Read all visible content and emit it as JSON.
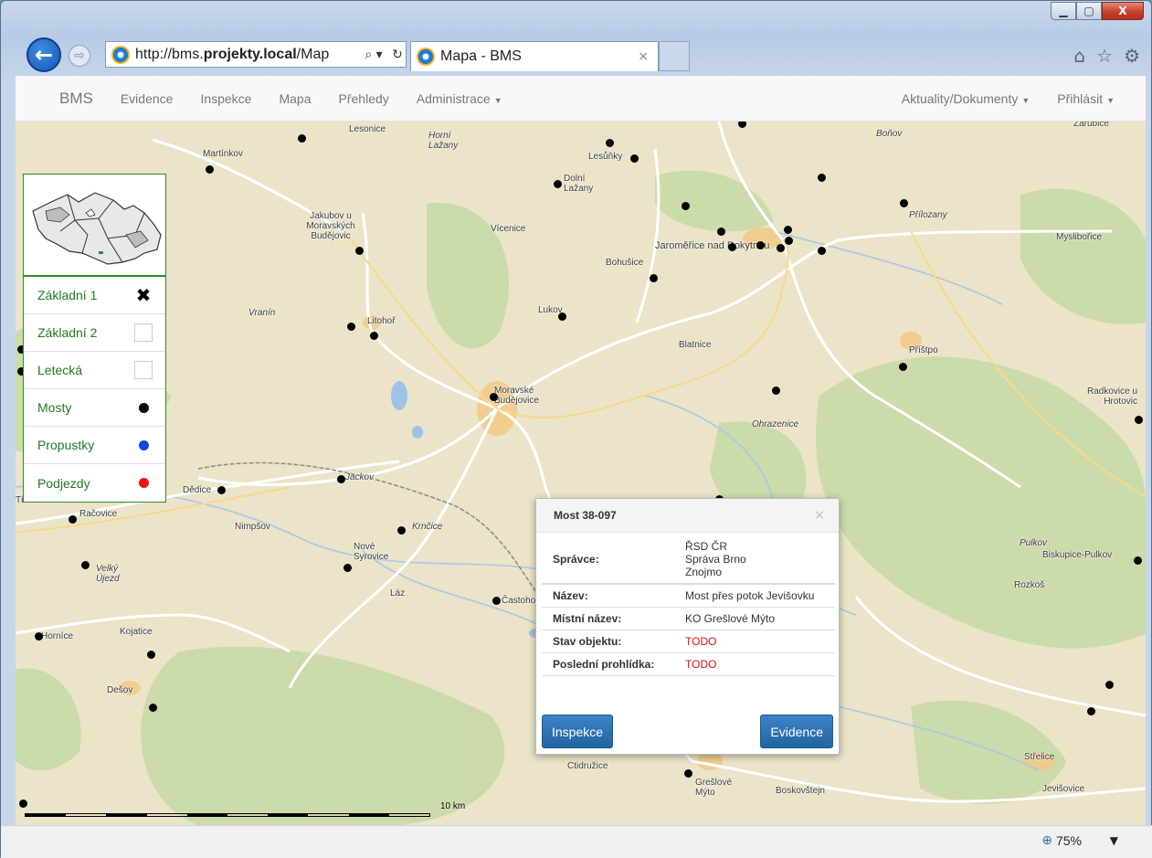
{
  "window": {
    "controls": [
      "▁",
      "▢",
      "X"
    ]
  },
  "browser": {
    "back_icon": "back-arrow-icon",
    "forward_icon": "forward-arrow-icon",
    "url_prefix": "http://bms.",
    "url_host": "projekty.local",
    "url_path": "/Map",
    "search_glyph": "⌕ ▾",
    "refresh_glyph": "↻",
    "tab_title": "Mapa - BMS",
    "tab_close": "×",
    "icons": [
      "home-icon",
      "star-icon",
      "gear-icon"
    ],
    "icon_glyphs": [
      "⌂",
      "☆",
      "⚙"
    ],
    "zoom_label": "75%",
    "zoom_glyph": "⊕",
    "zoom_dropdown": "▼"
  },
  "navbar": {
    "brand": "BMS",
    "items": [
      "Evidence",
      "Inspekce",
      "Mapa",
      "Přehledy",
      "Administrace"
    ],
    "right_items": [
      "Aktuality/Dokumenty",
      "Přihlásit"
    ]
  },
  "layers": [
    {
      "label": "Základní 1",
      "state": "checked"
    },
    {
      "label": "Základní 2",
      "state": "unchecked"
    },
    {
      "label": "Letecká",
      "state": "unchecked"
    },
    {
      "label": "Mosty",
      "color": "#000000"
    },
    {
      "label": "Propustky",
      "color": "#1144ee"
    },
    {
      "label": "Podjezdy",
      "color": "#ee1111"
    }
  ],
  "map": {
    "places": [
      "Lesonice",
      "Horní Lažany",
      "Martínkov",
      "Lesůňky",
      "Dolní Lažany",
      "Boňov",
      "Zárubice",
      "Jakubov u Moravských Budějovic",
      "Vícenice",
      "Jaroměřice nad Rokytnou",
      "Přílozany",
      "Myslibořice",
      "Bohušice",
      "Vranín",
      "Litohoř",
      "Lukov",
      "Blatnice",
      "Příštpo",
      "Moravské Budějovice",
      "Ohrazenice",
      "Radkovice u Hrotovic",
      "Jackov",
      "Dědice",
      "Třebelovice",
      "Račovice",
      "Nimpšov",
      "Krnčice",
      "Nové Syrovice",
      "Velký Újezd",
      "Láz",
      "Častohostice",
      "Pulkov",
      "Biskupice-Pulkov",
      "Rozkoš",
      "Horníce",
      "Kojatice",
      "Dešov",
      "Ctidružice",
      "Grešlové Mýto",
      "Boskovštejn",
      "Střelice",
      "Jevišovice"
    ],
    "scale_label": "10 km"
  },
  "popup": {
    "title": "Most 38-097",
    "close": "×",
    "rows": [
      {
        "label": "Správce:",
        "value_lines": [
          "ŘSD ČR",
          "Správa Brno",
          "Znojmo"
        ]
      },
      {
        "label": "Název:",
        "value": "Most přes potok Jevišovku"
      },
      {
        "label": "Místní název:",
        "value": "KO Grešlové Mýto"
      },
      {
        "label": "Stav objektu:",
        "value": "TODO",
        "status": "todo"
      },
      {
        "label": "Poslední prohlídka:",
        "value": "TODO",
        "status": "todo"
      }
    ],
    "buttons": {
      "left": "Inspekce",
      "right": "Evidence"
    }
  }
}
